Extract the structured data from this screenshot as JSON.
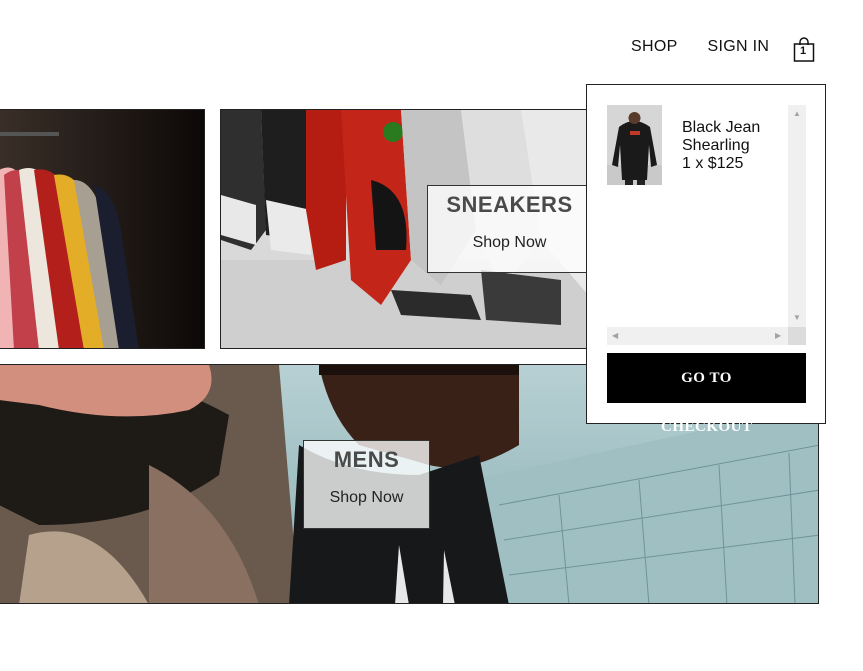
{
  "header": {
    "nav": {
      "shop": "SHOP",
      "sign_in": "SIGN IN"
    },
    "cart": {
      "icon": "shopping-bag-icon",
      "count": "1"
    }
  },
  "tiles": {
    "sneakers": {
      "title": "SNEAKERS",
      "cta": "Shop Now"
    },
    "mens": {
      "title": "MENS",
      "cta": "Shop Now"
    }
  },
  "cart_dropdown": {
    "items": [
      {
        "name": "Black Jean Shearling",
        "quantity_price": "1 x $125"
      }
    ],
    "checkout_label_line1": "GO TO",
    "checkout_label_line2": "CHECKOUT"
  },
  "colors": {
    "button_bg": "#000000",
    "text": "#111111"
  }
}
